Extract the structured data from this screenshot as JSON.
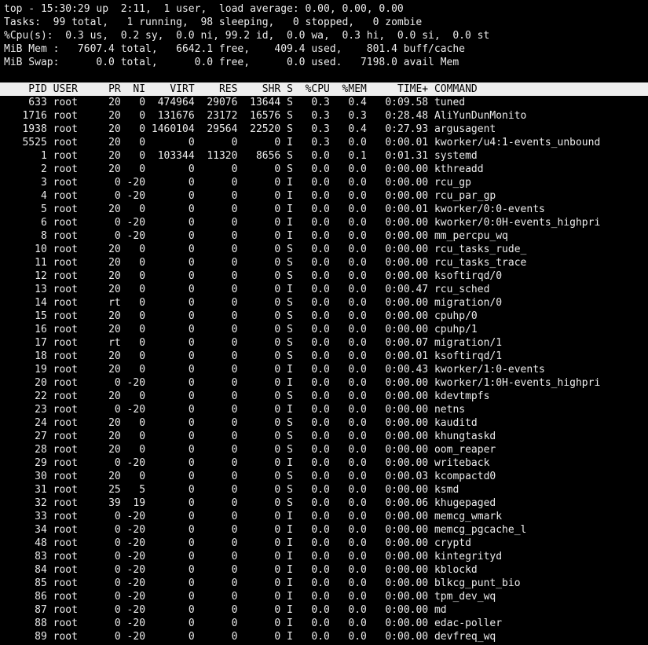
{
  "summary": {
    "uptime_line": "top - 15:30:29 up  2:11,  1 user,  load average: 0.00, 0.00, 0.00",
    "tasks_line": "Tasks:  99 total,   1 running,  98 sleeping,   0 stopped,   0 zombie",
    "cpu_line": "%Cpu(s):  0.3 us,  0.2 sy,  0.0 ni, 99.2 id,  0.0 wa,  0.3 hi,  0.0 si,  0.0 st",
    "mem_line": "MiB Mem :   7607.4 total,   6642.1 free,    409.4 used,    801.4 buff/cache",
    "swap_line": "MiB Swap:      0.0 total,      0.0 free,      0.0 used.   7198.0 avail Mem"
  },
  "columns": [
    "PID",
    "USER",
    "PR",
    "NI",
    "VIRT",
    "RES",
    "SHR",
    "S",
    "%CPU",
    "%MEM",
    "TIME+",
    "COMMAND"
  ],
  "processes": [
    [
      "633",
      "root",
      "20",
      "0",
      "474964",
      "29076",
      "13644",
      "S",
      "0.3",
      "0.4",
      "0:09.58",
      "tuned"
    ],
    [
      "1716",
      "root",
      "20",
      "0",
      "131676",
      "23172",
      "16576",
      "S",
      "0.3",
      "0.3",
      "0:28.48",
      "AliYunDunMonito"
    ],
    [
      "1938",
      "root",
      "20",
      "0",
      "1460104",
      "29564",
      "22520",
      "S",
      "0.3",
      "0.4",
      "0:27.93",
      "argusagent"
    ],
    [
      "5525",
      "root",
      "20",
      "0",
      "0",
      "0",
      "0",
      "I",
      "0.3",
      "0.0",
      "0:00.01",
      "kworker/u4:1-events_unbound"
    ],
    [
      "1",
      "root",
      "20",
      "0",
      "103344",
      "11320",
      "8656",
      "S",
      "0.0",
      "0.1",
      "0:01.31",
      "systemd"
    ],
    [
      "2",
      "root",
      "20",
      "0",
      "0",
      "0",
      "0",
      "S",
      "0.0",
      "0.0",
      "0:00.00",
      "kthreadd"
    ],
    [
      "3",
      "root",
      "0",
      "-20",
      "0",
      "0",
      "0",
      "I",
      "0.0",
      "0.0",
      "0:00.00",
      "rcu_gp"
    ],
    [
      "4",
      "root",
      "0",
      "-20",
      "0",
      "0",
      "0",
      "I",
      "0.0",
      "0.0",
      "0:00.00",
      "rcu_par_gp"
    ],
    [
      "5",
      "root",
      "20",
      "0",
      "0",
      "0",
      "0",
      "I",
      "0.0",
      "0.0",
      "0:00.01",
      "kworker/0:0-events"
    ],
    [
      "6",
      "root",
      "0",
      "-20",
      "0",
      "0",
      "0",
      "I",
      "0.0",
      "0.0",
      "0:00.00",
      "kworker/0:0H-events_highpri"
    ],
    [
      "8",
      "root",
      "0",
      "-20",
      "0",
      "0",
      "0",
      "I",
      "0.0",
      "0.0",
      "0:00.00",
      "mm_percpu_wq"
    ],
    [
      "10",
      "root",
      "20",
      "0",
      "0",
      "0",
      "0",
      "S",
      "0.0",
      "0.0",
      "0:00.00",
      "rcu_tasks_rude_"
    ],
    [
      "11",
      "root",
      "20",
      "0",
      "0",
      "0",
      "0",
      "S",
      "0.0",
      "0.0",
      "0:00.00",
      "rcu_tasks_trace"
    ],
    [
      "12",
      "root",
      "20",
      "0",
      "0",
      "0",
      "0",
      "S",
      "0.0",
      "0.0",
      "0:00.00",
      "ksoftirqd/0"
    ],
    [
      "13",
      "root",
      "20",
      "0",
      "0",
      "0",
      "0",
      "I",
      "0.0",
      "0.0",
      "0:00.47",
      "rcu_sched"
    ],
    [
      "14",
      "root",
      "rt",
      "0",
      "0",
      "0",
      "0",
      "S",
      "0.0",
      "0.0",
      "0:00.00",
      "migration/0"
    ],
    [
      "15",
      "root",
      "20",
      "0",
      "0",
      "0",
      "0",
      "S",
      "0.0",
      "0.0",
      "0:00.00",
      "cpuhp/0"
    ],
    [
      "16",
      "root",
      "20",
      "0",
      "0",
      "0",
      "0",
      "S",
      "0.0",
      "0.0",
      "0:00.00",
      "cpuhp/1"
    ],
    [
      "17",
      "root",
      "rt",
      "0",
      "0",
      "0",
      "0",
      "S",
      "0.0",
      "0.0",
      "0:00.07",
      "migration/1"
    ],
    [
      "18",
      "root",
      "20",
      "0",
      "0",
      "0",
      "0",
      "S",
      "0.0",
      "0.0",
      "0:00.01",
      "ksoftirqd/1"
    ],
    [
      "19",
      "root",
      "20",
      "0",
      "0",
      "0",
      "0",
      "I",
      "0.0",
      "0.0",
      "0:00.43",
      "kworker/1:0-events"
    ],
    [
      "20",
      "root",
      "0",
      "-20",
      "0",
      "0",
      "0",
      "I",
      "0.0",
      "0.0",
      "0:00.00",
      "kworker/1:0H-events_highpri"
    ],
    [
      "22",
      "root",
      "20",
      "0",
      "0",
      "0",
      "0",
      "S",
      "0.0",
      "0.0",
      "0:00.00",
      "kdevtmpfs"
    ],
    [
      "23",
      "root",
      "0",
      "-20",
      "0",
      "0",
      "0",
      "I",
      "0.0",
      "0.0",
      "0:00.00",
      "netns"
    ],
    [
      "24",
      "root",
      "20",
      "0",
      "0",
      "0",
      "0",
      "S",
      "0.0",
      "0.0",
      "0:00.00",
      "kauditd"
    ],
    [
      "27",
      "root",
      "20",
      "0",
      "0",
      "0",
      "0",
      "S",
      "0.0",
      "0.0",
      "0:00.00",
      "khungtaskd"
    ],
    [
      "28",
      "root",
      "20",
      "0",
      "0",
      "0",
      "0",
      "S",
      "0.0",
      "0.0",
      "0:00.00",
      "oom_reaper"
    ],
    [
      "29",
      "root",
      "0",
      "-20",
      "0",
      "0",
      "0",
      "I",
      "0.0",
      "0.0",
      "0:00.00",
      "writeback"
    ],
    [
      "30",
      "root",
      "20",
      "0",
      "0",
      "0",
      "0",
      "S",
      "0.0",
      "0.0",
      "0:00.03",
      "kcompactd0"
    ],
    [
      "31",
      "root",
      "25",
      "5",
      "0",
      "0",
      "0",
      "S",
      "0.0",
      "0.0",
      "0:00.00",
      "ksmd"
    ],
    [
      "32",
      "root",
      "39",
      "19",
      "0",
      "0",
      "0",
      "S",
      "0.0",
      "0.0",
      "0:00.06",
      "khugepaged"
    ],
    [
      "33",
      "root",
      "0",
      "-20",
      "0",
      "0",
      "0",
      "I",
      "0.0",
      "0.0",
      "0:00.00",
      "memcg_wmark"
    ],
    [
      "34",
      "root",
      "0",
      "-20",
      "0",
      "0",
      "0",
      "I",
      "0.0",
      "0.0",
      "0:00.00",
      "memcg_pgcache_l"
    ],
    [
      "48",
      "root",
      "0",
      "-20",
      "0",
      "0",
      "0",
      "I",
      "0.0",
      "0.0",
      "0:00.00",
      "cryptd"
    ],
    [
      "83",
      "root",
      "0",
      "-20",
      "0",
      "0",
      "0",
      "I",
      "0.0",
      "0.0",
      "0:00.00",
      "kintegrityd"
    ],
    [
      "84",
      "root",
      "0",
      "-20",
      "0",
      "0",
      "0",
      "I",
      "0.0",
      "0.0",
      "0:00.00",
      "kblockd"
    ],
    [
      "85",
      "root",
      "0",
      "-20",
      "0",
      "0",
      "0",
      "I",
      "0.0",
      "0.0",
      "0:00.00",
      "blkcg_punt_bio"
    ],
    [
      "86",
      "root",
      "0",
      "-20",
      "0",
      "0",
      "0",
      "I",
      "0.0",
      "0.0",
      "0:00.00",
      "tpm_dev_wq"
    ],
    [
      "87",
      "root",
      "0",
      "-20",
      "0",
      "0",
      "0",
      "I",
      "0.0",
      "0.0",
      "0:00.00",
      "md"
    ],
    [
      "88",
      "root",
      "0",
      "-20",
      "0",
      "0",
      "0",
      "I",
      "0.0",
      "0.0",
      "0:00.00",
      "edac-poller"
    ],
    [
      "89",
      "root",
      "0",
      "-20",
      "0",
      "0",
      "0",
      "I",
      "0.0",
      "0.0",
      "0:00.00",
      "devfreq_wq"
    ]
  ],
  "colors": {
    "background": "#000000",
    "text": "#ececec",
    "header_bg": "#eeeeee",
    "header_text": "#000000"
  }
}
